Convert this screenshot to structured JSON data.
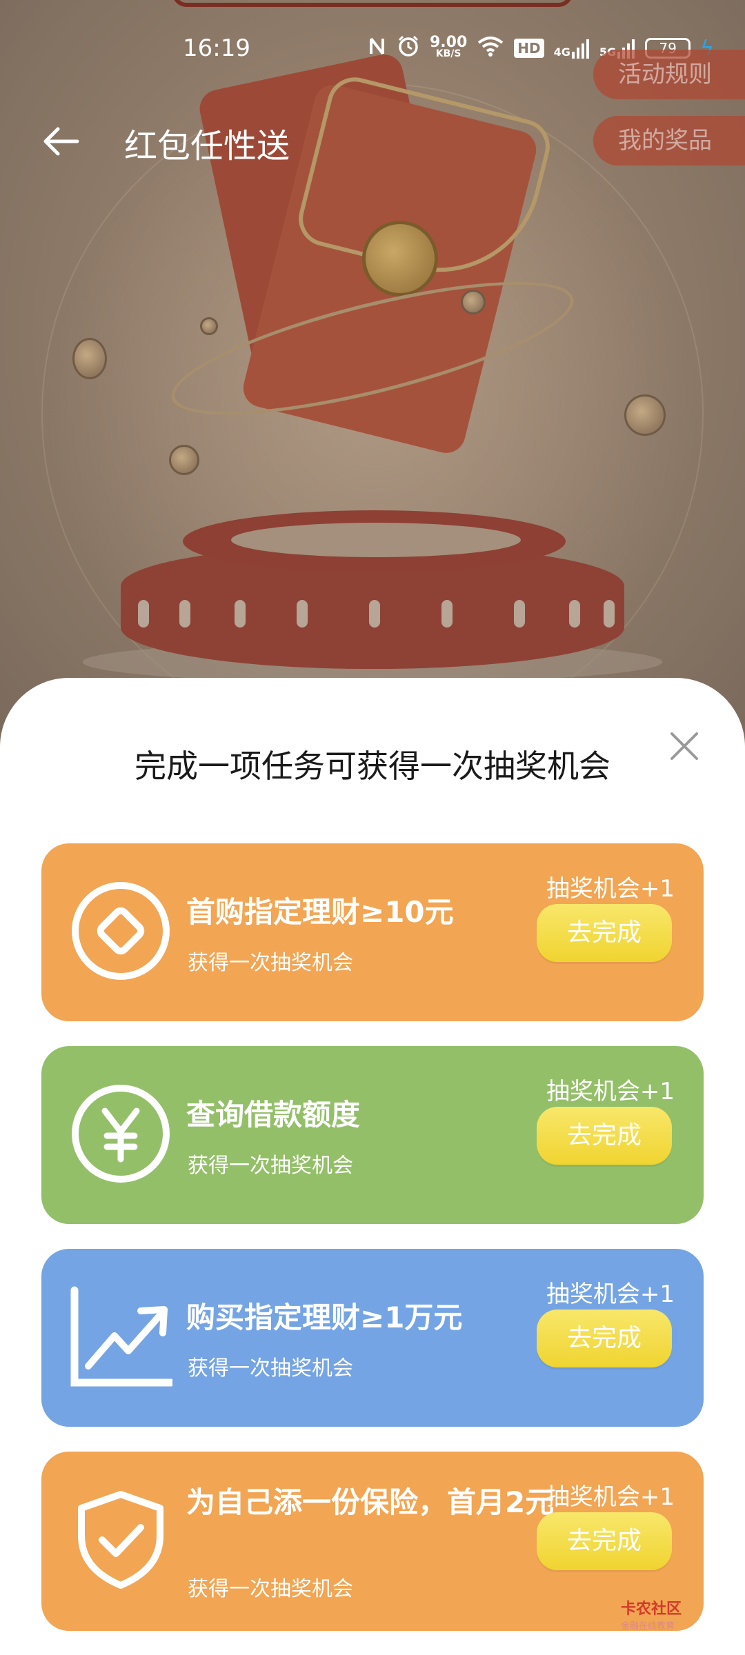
{
  "status_bar": {
    "time": "16:19",
    "net_speed_value": "9.00",
    "net_speed_unit": "KB/S",
    "hd_label": "HD",
    "sig1_label": "4G",
    "sig2_label": "5G",
    "battery": "79"
  },
  "header": {
    "title": "红包任性送",
    "rules_label": "活动规则",
    "prizes_label": "我的奖品"
  },
  "sheet": {
    "title": "完成一项任务可获得一次抽奖机会",
    "tasks": [
      {
        "icon": "diamond-coin-icon",
        "title": "首购指定理财≥10元",
        "subtitle": "获得一次抽奖机会",
        "chance": "抽奖机会+1",
        "button": "去完成"
      },
      {
        "icon": "yen-coin-icon",
        "title": "查询借款额度",
        "subtitle": "获得一次抽奖机会",
        "chance": "抽奖机会+1",
        "button": "去完成"
      },
      {
        "icon": "trend-up-icon",
        "title": "购买指定理财≥1万元",
        "subtitle": "获得一次抽奖机会",
        "chance": "抽奖机会+1",
        "button": "去完成"
      },
      {
        "icon": "shield-check-icon",
        "title": "为自己添一份保险，首月2元",
        "subtitle": "获得一次抽奖机会",
        "chance": "抽奖机会+1",
        "button": "去完成"
      }
    ]
  },
  "watermark": {
    "name": "卡农社区",
    "slogan": "金融在线教育"
  },
  "colors": {
    "orange_card": "#f2a553",
    "green_card": "#93bf69",
    "blue_card": "#74a4e3",
    "button_yellow": "#f3da3c"
  }
}
